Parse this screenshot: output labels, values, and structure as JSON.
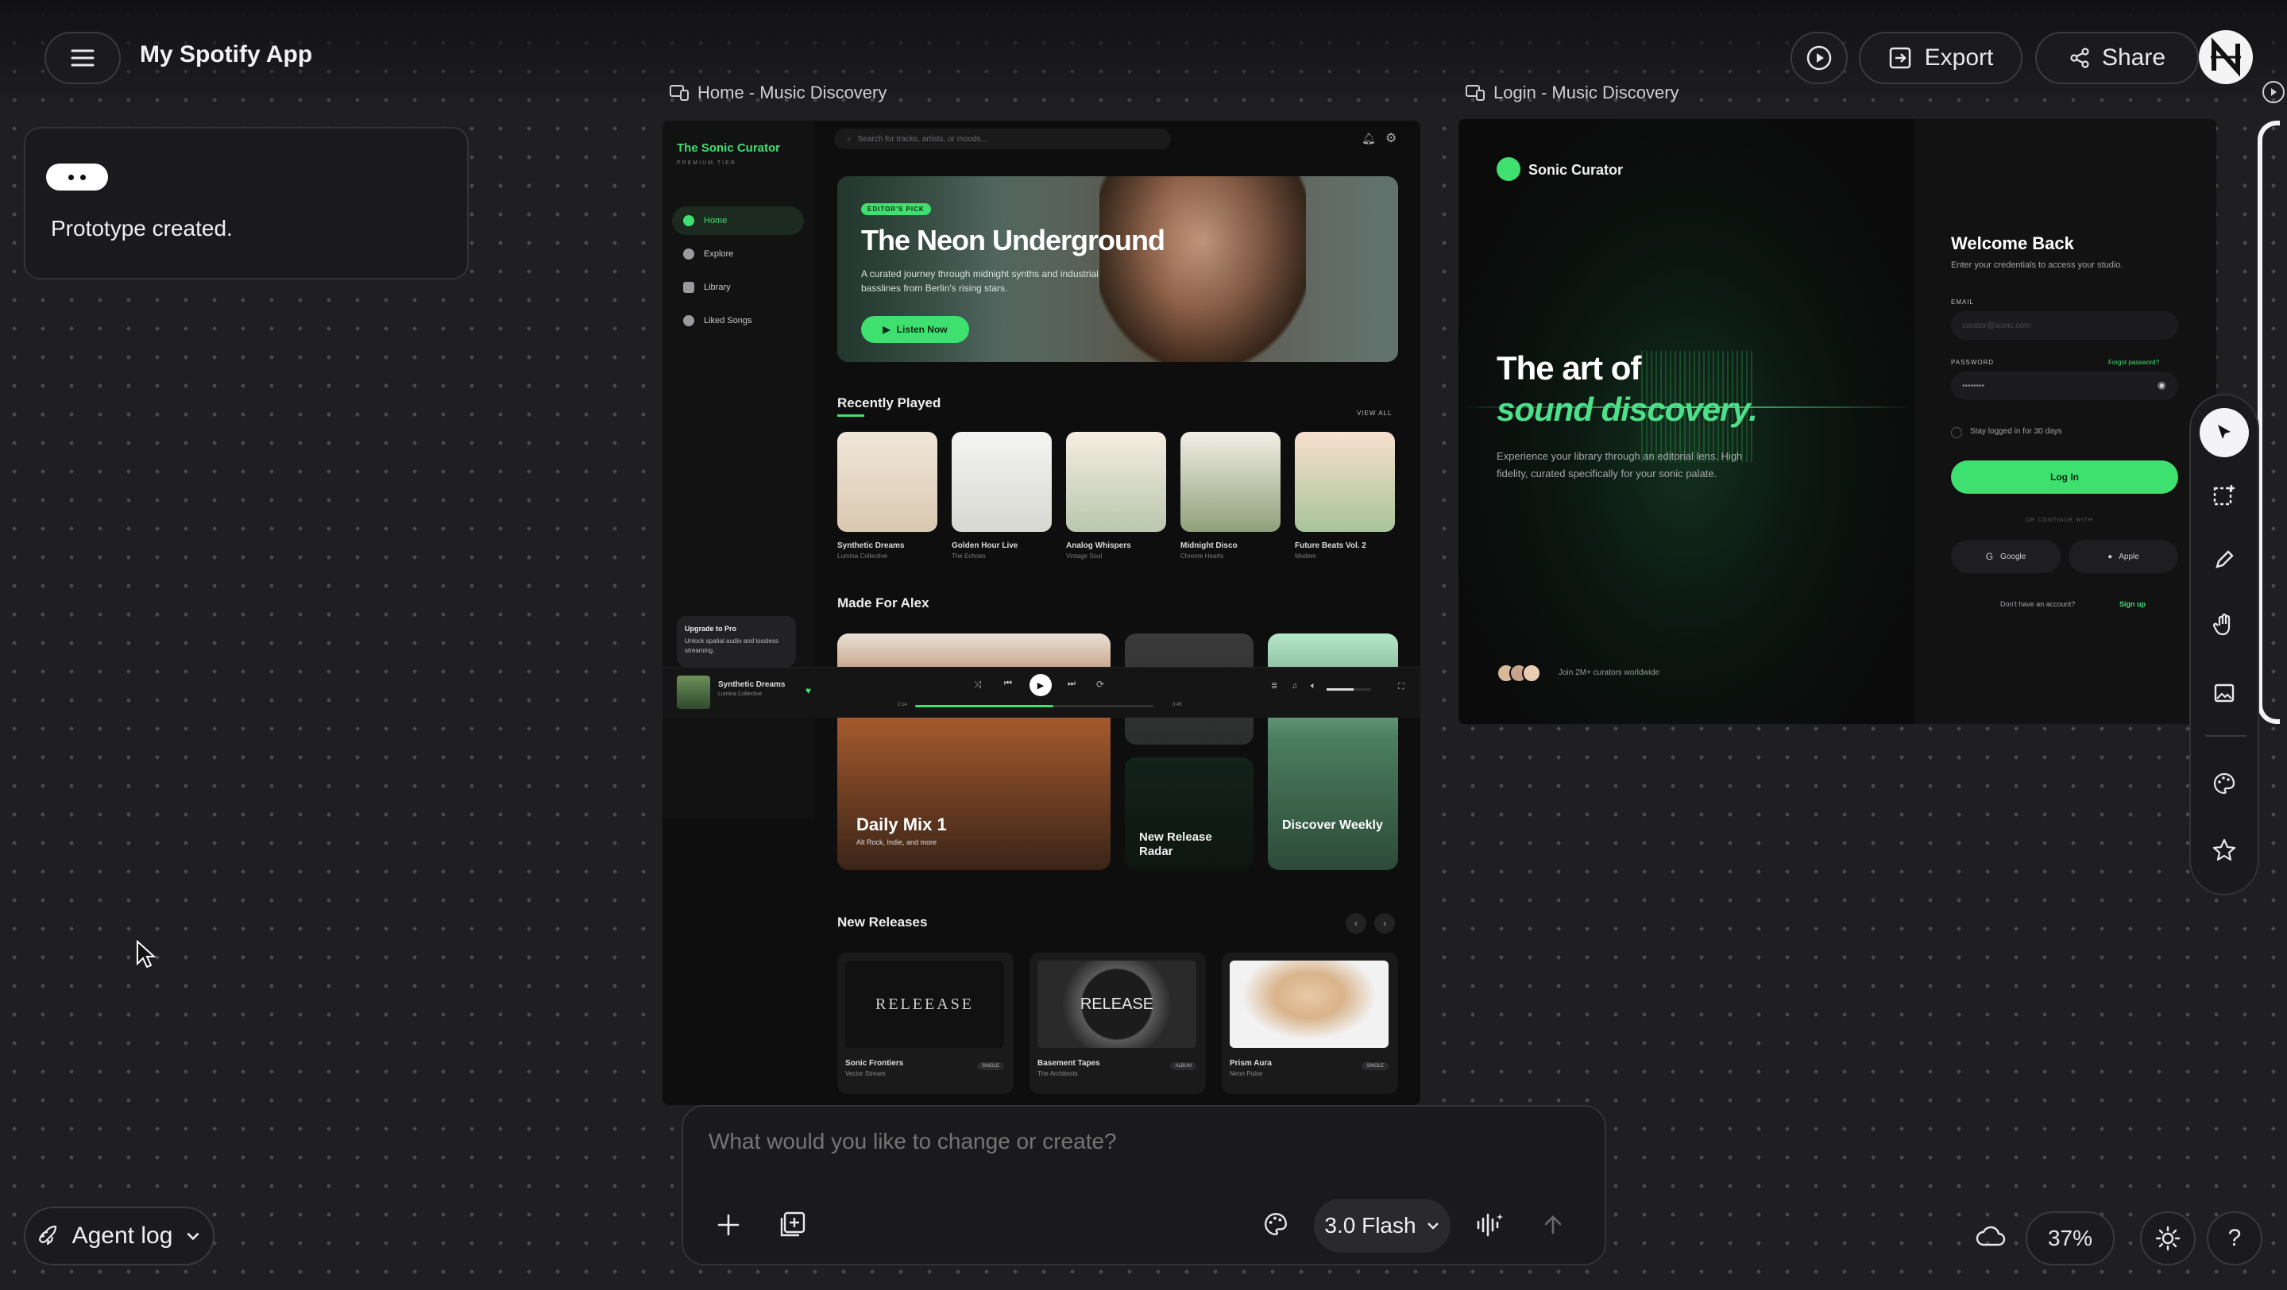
{
  "app": {
    "title": "My Spotify App"
  },
  "toolbar": {
    "export_label": "Export",
    "share_label": "Share"
  },
  "chat": {
    "message": "Prototype created."
  },
  "frames": {
    "home_label": "Home - Music Discovery",
    "login_label": "Login - Music Discovery"
  },
  "home": {
    "brand": "The Sonic Curator",
    "tier": "PREMIUM TIER",
    "nav": [
      {
        "label": "Home"
      },
      {
        "label": "Explore"
      },
      {
        "label": "Library"
      },
      {
        "label": "Liked Songs"
      }
    ],
    "upgrade": {
      "title": "Upgrade to Pro",
      "text": "Unlock spatial audio and lossless streaming."
    },
    "search_placeholder": "Search for tracks, artists, or moods...",
    "hero": {
      "badge": "EDITOR'S PICK",
      "title": "The Neon Underground",
      "subtitle": "A curated journey through midnight synths and industrial basslines from Berlin's rising stars.",
      "button": "Listen Now"
    },
    "recent": {
      "title": "Recently Played",
      "view_all": "VIEW ALL",
      "items": [
        {
          "title": "Synthetic Dreams",
          "artist": "Lumina Collective"
        },
        {
          "title": "Golden Hour Live",
          "artist": "The Echoes"
        },
        {
          "title": "Analog Whispers",
          "artist": "Vintage Soul"
        },
        {
          "title": "Midnight Disco",
          "artist": "Chrome Hearts"
        },
        {
          "title": "Future Beats Vol. 2",
          "artist": "Modem"
        }
      ]
    },
    "made_for": {
      "title": "Made For Alex",
      "mixes": [
        {
          "title": "Daily Mix 1",
          "sub": "Alt Rock, Indie, and more"
        },
        {
          "title": "New Release Radar",
          "sub": ""
        },
        {
          "title": "Discover Weekly",
          "sub": ""
        }
      ]
    },
    "player": {
      "track": "Synthetic Dreams",
      "artist": "Lumina Collective",
      "elapsed": "2:14",
      "total": "3:45",
      "progress": 0.58,
      "volume": 0.6
    },
    "new_releases": {
      "title": "New Releases",
      "items": [
        {
          "title": "Sonic Frontiers",
          "artist": "Vector Stream",
          "tag": "SINGLE",
          "cover_text": "RELEEASE"
        },
        {
          "title": "Basement Tapes",
          "artist": "The Architects",
          "tag": "ALBUM",
          "cover_text": "RELEASE"
        },
        {
          "title": "Prism Aura",
          "artist": "Neon Pulse",
          "tag": "SINGLE",
          "cover_text": ""
        }
      ]
    }
  },
  "login": {
    "brand": "Sonic Curator",
    "headline_1": "The art of",
    "headline_2": "sound discovery.",
    "description": "Experience your library through an editorial lens. High fidelity, curated specifically for your sonic palate.",
    "joined": "Join 2M+ curators worldwide",
    "welcome": "Welcome Back",
    "instructions": "Enter your credentials to access your studio.",
    "email_label": "EMAIL",
    "email_placeholder": "curator@sonic.com",
    "password_label": "PASSWORD",
    "forgot": "Forgot password?",
    "password_value": "••••••••",
    "stay": "Stay logged in for 30 days",
    "login_button": "Log In",
    "or_continue": "OR CONTINUE WITH",
    "google": "Google",
    "apple": "Apple",
    "no_account": "Don't have an account?",
    "signup": "Sign up"
  },
  "prompt": {
    "placeholder": "What would you like to change or create?",
    "model": "3.0 Flash"
  },
  "agent_log": {
    "label": "Agent log"
  },
  "zoom": {
    "value": "37%"
  },
  "colors": {
    "accent": "#3ee06f",
    "background": "#1f1f21"
  }
}
